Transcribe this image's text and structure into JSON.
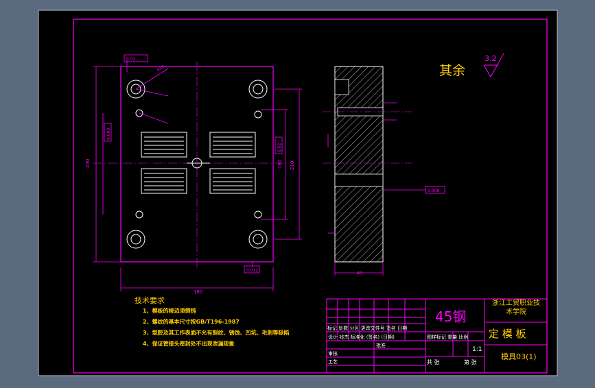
{
  "drawing": {
    "roughness_label": "其余",
    "roughness_value": "3.2",
    "material": "45钢",
    "school": [
      "浙江工贸职业技",
      "术学院"
    ],
    "part_name": "定 模 板",
    "drawing_no": "模具03(1)",
    "scale": "1:1"
  },
  "tech_requirements": {
    "title": "技术要求",
    "items": [
      "1、模板的棱边须倒钝",
      "2、螺纹的基本尺寸按GB/T196-1987",
      "3、型腔及其工作表面不允有裂纹、锈蚀、凹坑、毛刺等缺陷",
      "4、保证管接头密封处不出现泄漏现象"
    ]
  },
  "title_block": {
    "row_labels": [
      "标记",
      "处数",
      "分区",
      "更改文件号",
      "签名",
      "日期"
    ],
    "design_row": [
      "设计",
      "钱杰",
      "标准化",
      "(签名)",
      "(日期)"
    ],
    "stage_labels": [
      "图样标记",
      "重量",
      "比例"
    ],
    "review": "审核",
    "process": "工艺",
    "approve": "批准",
    "total_sheets": "共  张",
    "sheet_no": "第  张"
  },
  "dimensions": {
    "d1": "180",
    "d2": "230",
    "d3": "40",
    "d4": "ø12",
    "tol1": "0.02",
    "tol2": "0.008",
    "tol3": "0.012",
    "tol4": "0.02",
    "tol5": "0.008"
  },
  "colors": {
    "background": "#000000",
    "frame": "#ff00ff",
    "lines": "#ffffff",
    "annotation": "#ffcc00",
    "outer": "#5a6a7f"
  }
}
